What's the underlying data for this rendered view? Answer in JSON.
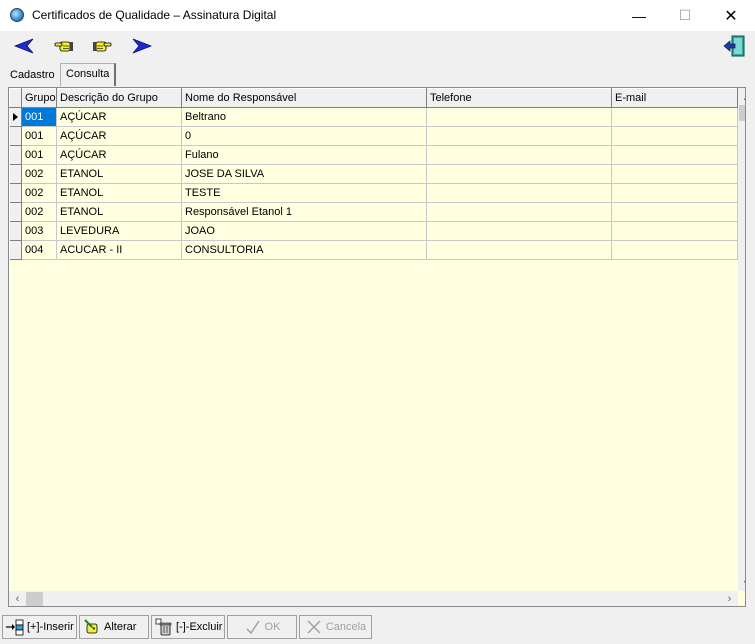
{
  "window": {
    "title": "Certificados de Qualidade – Assinatura Digital",
    "minimize": "—",
    "maximize": "☐",
    "close": "✕"
  },
  "toolbar": {
    "items": [
      {
        "icon": "arrow-left-icon",
        "color": "#1f2ad0"
      },
      {
        "icon": "hand-point-left-icon",
        "color": "#e8e000"
      },
      {
        "icon": "hand-point-right-icon",
        "color": "#e8e000"
      },
      {
        "icon": "arrow-right-icon",
        "color": "#1f2ad0"
      },
      {
        "icon": "exit-door-icon",
        "color": "#2aa6a0"
      }
    ]
  },
  "tabs": [
    {
      "label": "Cadastro",
      "active": false
    },
    {
      "label": "Consulta",
      "active": true
    }
  ],
  "grid": {
    "columns": [
      "Grupo",
      "Descrição do Grupo",
      "Nome do Responsável",
      "Telefone",
      "E-mail"
    ],
    "rows": [
      {
        "grupo": "001",
        "descricao": "AÇÚCAR",
        "nome": "Beltrano",
        "telefone": "",
        "email": ""
      },
      {
        "grupo": "001",
        "descricao": "AÇÚCAR",
        "nome": "0",
        "telefone": "",
        "email": ""
      },
      {
        "grupo": "001",
        "descricao": "AÇÚCAR",
        "nome": "Fulano",
        "telefone": "",
        "email": ""
      },
      {
        "grupo": "002",
        "descricao": "ETANOL",
        "nome": "JOSE DA SILVA",
        "telefone": "",
        "email": ""
      },
      {
        "grupo": "002",
        "descricao": "ETANOL",
        "nome": "TESTE",
        "telefone": "",
        "email": ""
      },
      {
        "grupo": "002",
        "descricao": "ETANOL",
        "nome": "Responsável Etanol 1",
        "telefone": "",
        "email": ""
      },
      {
        "grupo": "003",
        "descricao": "LEVEDURA",
        "nome": "JOAO",
        "telefone": "",
        "email": ""
      },
      {
        "grupo": "004",
        "descricao": "ACUCAR - II",
        "nome": "CONSULTORIA",
        "telefone": "",
        "email": ""
      }
    ],
    "selected_row": 0,
    "background": "#ffffe1",
    "selection_color": "#0078d7"
  },
  "buttons": {
    "inserir": "[+]-Inserir",
    "alterar": "Alterar",
    "excluir": "[-]-Excluir",
    "ok": "OK",
    "cancela": "Cancela"
  }
}
